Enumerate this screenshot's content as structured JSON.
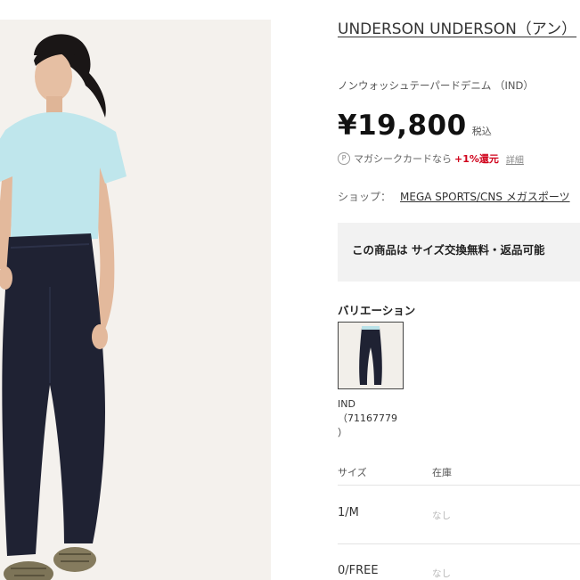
{
  "product": {
    "title": "UNDERSON UNDERSON（アン）",
    "subtitle": "ノンウォッシュテーパードデニム （IND）",
    "price": "¥19,800",
    "tax_label": "税込",
    "points": {
      "icon": "P",
      "text": "マガシークカードなら",
      "bonus": "+1%還元",
      "detail_link": "詳細"
    },
    "shop": {
      "label": "ショップ：",
      "name": "MEGA SPORTS/CNS メガスポーツ"
    },
    "notice": "この商品は サイズ交換無料・返品可能"
  },
  "variation": {
    "heading": "バリエーション",
    "color": "IND",
    "code_line1": "（71167779",
    "code_line2": "）"
  },
  "stock_table": {
    "headers": [
      "サイズ",
      "在庫"
    ],
    "rows": [
      {
        "size": "1/M",
        "stock": "なし"
      },
      {
        "size": "0/FREE",
        "stock": "なし"
      }
    ]
  },
  "colors": {
    "accent_red": "#d0021b",
    "denim": "#1f2233",
    "shirt": "#bfe6ec"
  }
}
